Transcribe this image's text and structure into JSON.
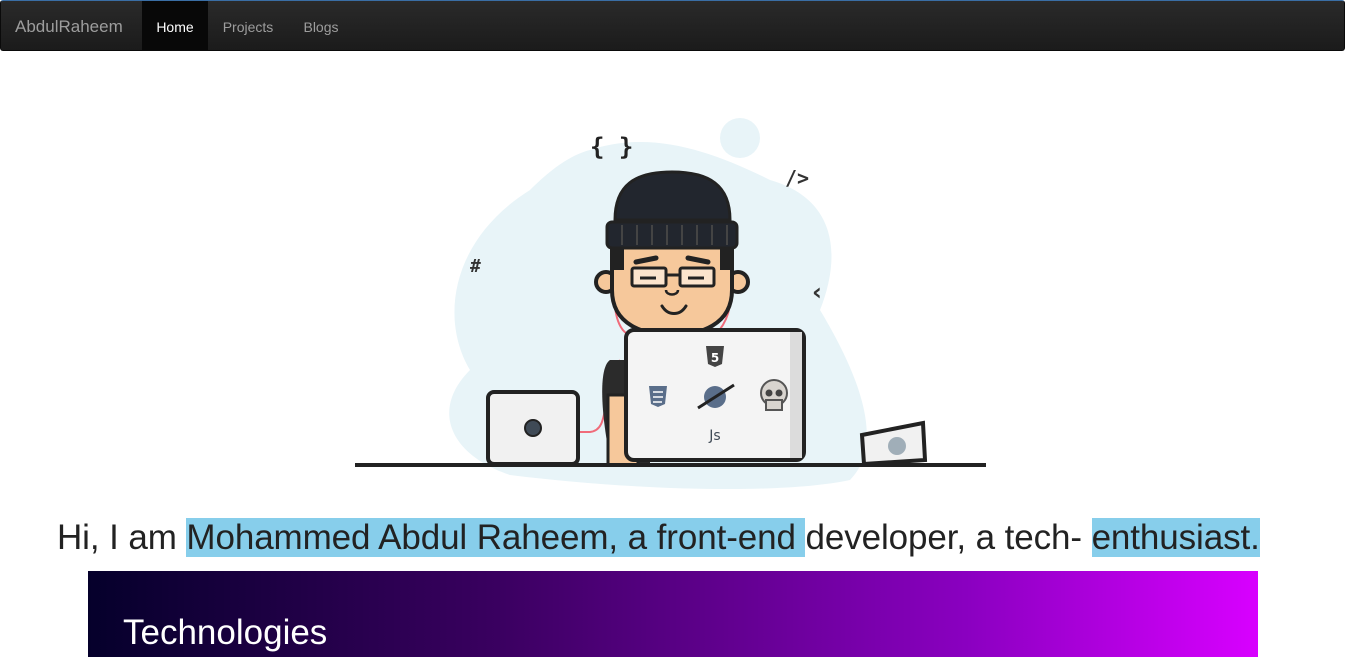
{
  "navbar": {
    "brand": "AbdulRaheem",
    "items": [
      {
        "label": "Home",
        "active": true
      },
      {
        "label": "Projects",
        "active": false
      },
      {
        "label": "Blogs",
        "active": false
      }
    ]
  },
  "hero": {
    "symbols": {
      "braces": "{ }",
      "tag": "/>",
      "hash": "#",
      "chevron": "‹",
      "js": "Js",
      "html5": "5"
    }
  },
  "intro": {
    "prefix": "Hi, I am ",
    "highlight1": "Mohammed Abdul Raheem, a front-end ",
    "middle": "developer, a tech- ",
    "highlight2": "enthusiast."
  },
  "technologies": {
    "title": "Technologies"
  },
  "colors": {
    "navbar_bg": "#222222",
    "highlight": "#87ceeb",
    "banner_start": "#05002b",
    "banner_end": "#d800ff"
  }
}
